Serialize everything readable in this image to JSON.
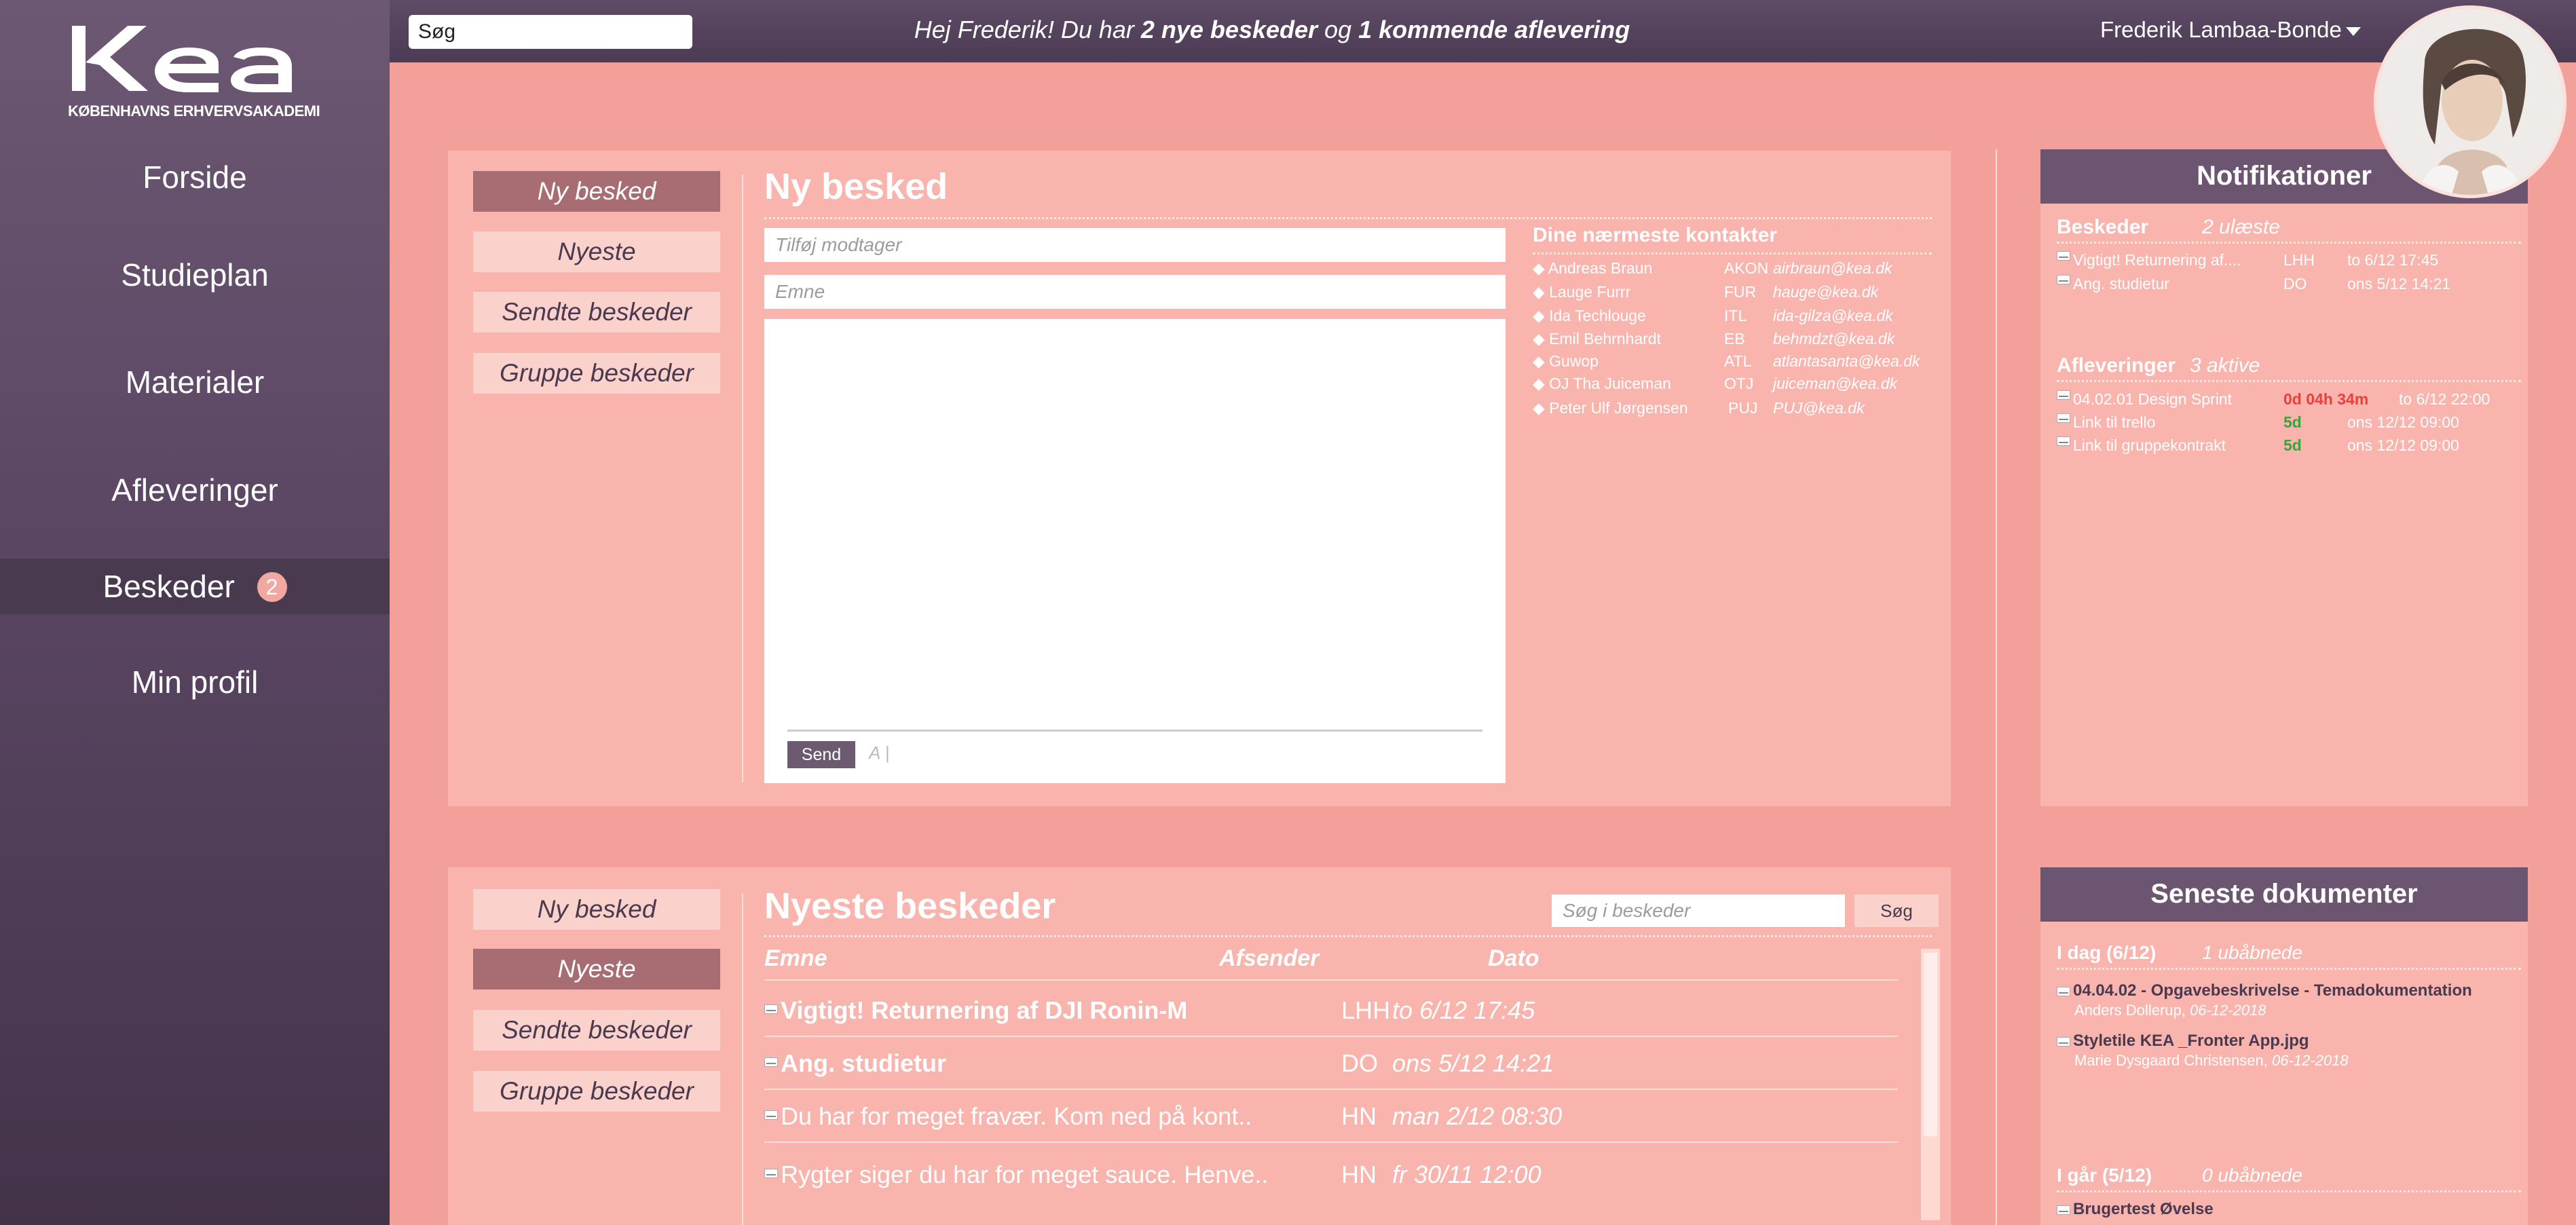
{
  "sidebar": {
    "logo_text": "kea",
    "logo_subtitle": "KØBENHAVNS ERHVERVSAKADEMI",
    "items": [
      {
        "label": "Forside"
      },
      {
        "label": "Studieplan"
      },
      {
        "label": "Materialer"
      },
      {
        "label": "Afleveringer"
      },
      {
        "label": "Beskeder",
        "badge": "2"
      },
      {
        "label": "Min profil"
      }
    ]
  },
  "topbar": {
    "search_value": "Søg",
    "greeting_pre": "Hej Frederik! Du har ",
    "greeting_new": "2 nye beskeder",
    "greeting_mid": " og ",
    "greeting_due": "1 kommende aflevering",
    "user_name": "Frederik Lambaa-Bonde"
  },
  "subnav": {
    "new": "Ny besked",
    "latest": "Nyeste",
    "sent": "Sendte beskeder",
    "group": "Gruppe beskeder"
  },
  "compose": {
    "title": "Ny besked",
    "to_placeholder": "Tilføj modtager",
    "subject_placeholder": "Emne",
    "send_label": "Send",
    "format_glyph": "A"
  },
  "contacts": {
    "title": "Dine nærmeste kontakter",
    "rows": [
      {
        "name": "◆ Andreas Braun",
        "code": "AKON",
        "email": "airbraun@kea.dk"
      },
      {
        "name": "◆ Lauge Furrr",
        "code": "FUR",
        "email": "hauge@kea.dk"
      },
      {
        "name": "◆ Ida Techlouge",
        "code": "ITL",
        "email": "ida-gilza@kea.dk"
      },
      {
        "name": "◆ Emil Behrnhardt",
        "code": "EB",
        "email": "behmdzt@kea.dk"
      },
      {
        "name": "◆ Guwop",
        "code": "ATL",
        "email": "atlantasanta@kea.dk"
      },
      {
        "name": "◆ OJ Tha Juiceman",
        "code": "OTJ",
        "email": "juiceman@kea.dk"
      },
      {
        "name": "◆ Peter Ulf Jørgensen",
        "code": "PUJ",
        "email": "PUJ@kea.dk"
      }
    ]
  },
  "notifications": {
    "title": "Notifikationer",
    "messages_label": "Beskeder",
    "messages_count": "2 ulæste",
    "messages": [
      {
        "subject": "Vigtigt! Returnering af....",
        "from": "LHH",
        "date": "to 6/12 17:45"
      },
      {
        "subject": "Ang. studietur",
        "from": "DO",
        "date": "ons 5/12 14:21"
      }
    ],
    "deliveries_label": "Afleveringer",
    "deliveries_count": "3 aktive",
    "deliveries": [
      {
        "name": "04.02.01 Design Sprint",
        "remaining": "0d 04h 34m",
        "remaining_color": "#e8403a",
        "date": "to 6/12 22:00"
      },
      {
        "name": "Link til trello",
        "remaining": "5d",
        "remaining_color": "#3aa43a",
        "date": "ons 12/12  09:00"
      },
      {
        "name": "Link til gruppekontrakt",
        "remaining": "5d",
        "remaining_color": "#3aa43a",
        "date": "ons 12/12  09:00"
      }
    ]
  },
  "messages_list": {
    "title": "Nyeste beskeder",
    "search_placeholder": "Søg i beskeder",
    "search_button": "Søg",
    "col_subject": "Emne",
    "col_sender": "Afsender",
    "col_date": "Dato",
    "rows": [
      {
        "subject": "Vigtigt! Returnering af DJI Ronin-M",
        "sender": "LHH",
        "date": "to 6/12 17:45",
        "unread": true
      },
      {
        "subject": "Ang. studietur",
        "sender": "DO",
        "date": "ons 5/12 14:21",
        "unread": true
      },
      {
        "subject": "Du har for meget fravær. Kom ned på kont..",
        "sender": "HN",
        "date": "man 2/12 08:30",
        "unread": false
      },
      {
        "subject": "Rygter siger du har for meget sauce. Henve..",
        "sender": "HN",
        "date": "fr 30/11 12:00",
        "unread": false
      }
    ]
  },
  "documents": {
    "title": "Seneste dokumenter",
    "today_label": "I dag (6/12)",
    "today_count": "1 ubåbnede",
    "today": [
      {
        "name": "04.04.02 - Opgavebeskrivelse - Temadokumentation",
        "author": "Anders Dollerup,",
        "date": "06-12-2018"
      },
      {
        "name": "Styletile KEA _Fronter App.jpg",
        "author": "Marie Dysgaard Christensen,",
        "date": "06-12-2018"
      }
    ],
    "yesterday_label": "I går (5/12)",
    "yesterday_count": "0 ubåbnede",
    "yesterday": [
      {
        "name": "Brugertest Øvelse"
      }
    ]
  }
}
